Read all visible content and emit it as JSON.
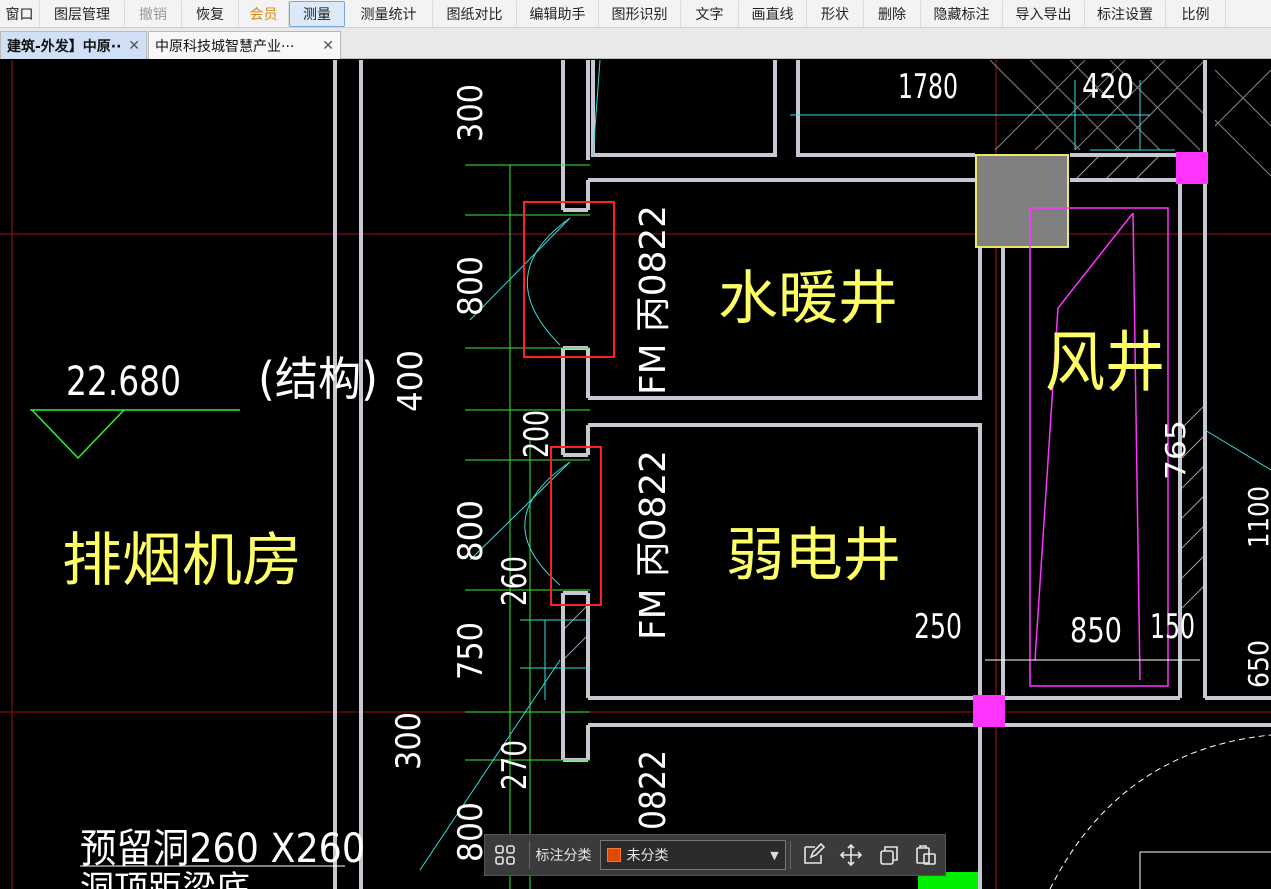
{
  "toolbar": {
    "items": [
      {
        "label": "窗口",
        "state": "normal"
      },
      {
        "label": "图层管理",
        "state": "normal"
      },
      {
        "label": "撤销",
        "state": "disabled"
      },
      {
        "label": "恢复",
        "state": "normal"
      },
      {
        "label": "会员",
        "state": "vip"
      },
      {
        "label": "测量",
        "state": "active"
      },
      {
        "label": "测量统计",
        "state": "normal"
      },
      {
        "label": "图纸对比",
        "state": "normal"
      },
      {
        "label": "编辑助手",
        "state": "normal"
      },
      {
        "label": "图形识别",
        "state": "normal"
      },
      {
        "label": "文字",
        "state": "normal"
      },
      {
        "label": "画直线",
        "state": "normal"
      },
      {
        "label": "形状",
        "state": "normal"
      },
      {
        "label": "删除",
        "state": "normal"
      },
      {
        "label": "隐藏标注",
        "state": "normal"
      },
      {
        "label": "导入导出",
        "state": "normal"
      },
      {
        "label": "标注设置",
        "state": "normal"
      },
      {
        "label": "比例",
        "state": "normal"
      }
    ]
  },
  "tabs": [
    {
      "label": "建筑-外发】中原··",
      "close": "✕"
    },
    {
      "label": "中原科技城智慧产业···",
      "close": "✕"
    }
  ],
  "drawing": {
    "room_labels": {
      "smoke_exhaust_room": "排烟机房",
      "hvac_shaft": "水暖井",
      "low_voltage_shaft": "弱电井",
      "air_shaft": "风井"
    },
    "elevation": "22.680",
    "structure_note": "(结构)",
    "door_tags": [
      "FM 丙0822",
      "FM 丙0822",
      "0822"
    ],
    "opening_note": "预留洞260 X260",
    "opening_note_partial": "洞顶距梁底",
    "dimensions": {
      "d1780": "1780",
      "d420": "420",
      "d300_top": "300",
      "d800_a": "800",
      "d400": "400",
      "d200": "200",
      "d800_b": "800",
      "d260": "260",
      "d750": "750",
      "d300_bottom": "300",
      "d270": "270",
      "d800_c": "800",
      "d250": "250",
      "d850": "850",
      "d150": "150",
      "d765": "765",
      "d1100": "1100",
      "d650": "650"
    }
  },
  "annotation_bar": {
    "class_label": "标注分类",
    "selected_class": "未分类",
    "swatch_color": "#e04a00"
  },
  "colors": {
    "background": "#000000",
    "wall": "#c8c8d2",
    "dimension": "#ffffff",
    "label_yellow": "#ffff66",
    "guide_green": "#33ee33",
    "guide_cyan": "#33dddd",
    "magenta": "#ff33ff",
    "highlight_red": "#ff2020"
  }
}
